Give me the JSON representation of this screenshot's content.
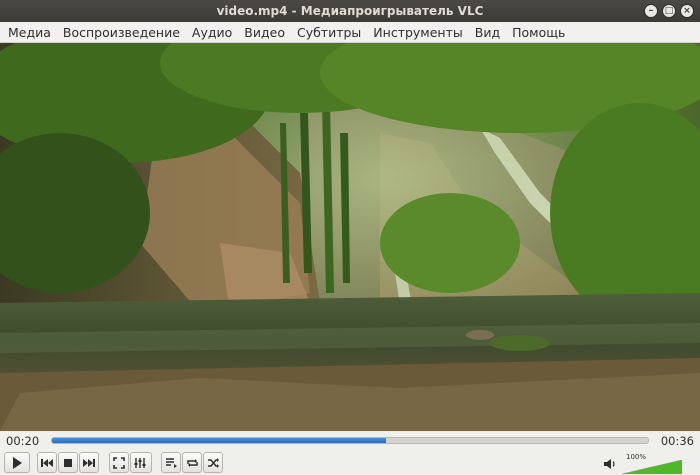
{
  "window": {
    "title": "video.mp4 - Медиапроигрыватель VLC"
  },
  "menu": {
    "items": [
      {
        "label": "Медиа"
      },
      {
        "label": "Воспроизведение"
      },
      {
        "label": "Аудио"
      },
      {
        "label": "Видео"
      },
      {
        "label": "Субтитры"
      },
      {
        "label": "Инструменты"
      },
      {
        "label": "Вид"
      },
      {
        "label": "Помощь"
      }
    ]
  },
  "playback": {
    "elapsed": "00:20",
    "total": "00:36",
    "progress": 0.56
  },
  "volume": {
    "label": "100%",
    "level": 1.0
  },
  "colors": {
    "accent": "#2d6cc0",
    "volume_green": "#4cb82a"
  },
  "icons": {
    "play": "play-icon",
    "previous": "previous-icon",
    "stop": "stop-icon",
    "next": "next-icon",
    "fullscreen": "fullscreen-icon",
    "extended": "extended-settings-icon",
    "playlist": "playlist-icon",
    "loop": "loop-icon",
    "shuffle": "shuffle-icon",
    "volume": "speaker-icon"
  }
}
